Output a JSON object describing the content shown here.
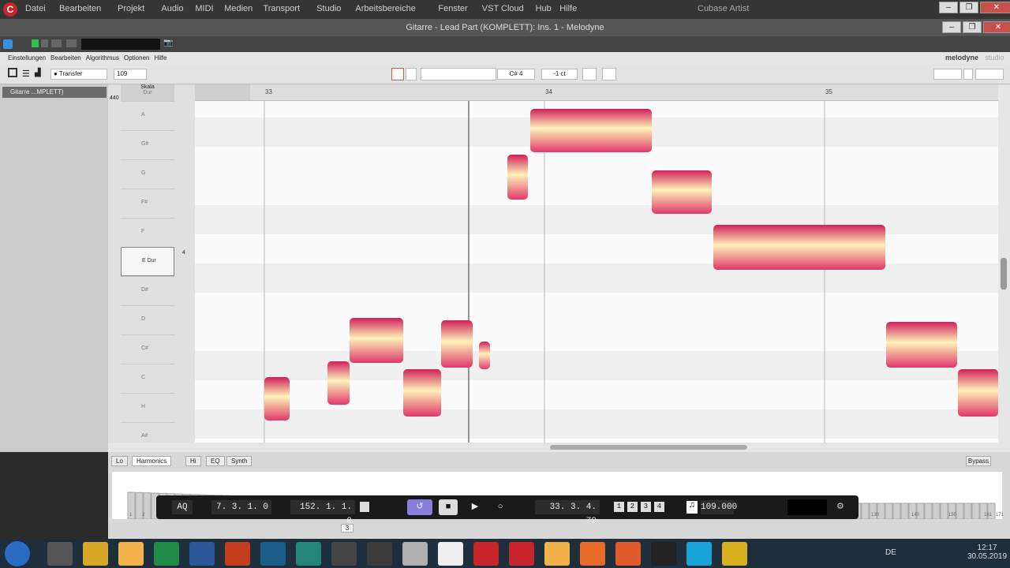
{
  "cubase": {
    "menu": [
      "Datei",
      "Bearbeiten",
      "Projekt",
      "Audio",
      "MIDI",
      "Medien",
      "Transport",
      "Studio",
      "Arbeitsbereiche",
      "Fenster",
      "VST Cloud",
      "Hub",
      "Hilfe"
    ],
    "app_name": "Cubase Artist"
  },
  "plugin": {
    "title": "Gitarre - Lead Part (KOMPLETT): Ins. 1 - Melodyne"
  },
  "melodyne": {
    "menu": [
      "Einstellungen",
      "Bearbeiten",
      "Algorithmus",
      "Optionen",
      "Hilfe"
    ],
    "brand": "melodyne",
    "brand_edition": "studio",
    "transfer_label": "Transfer",
    "tempo": "109",
    "pitch_note": "C# 4",
    "cents": "-1 ct",
    "track_name": "Gitarre ...MPLETT)",
    "scale_header": "Skala",
    "scale_sub": "Dur",
    "ref_pitch": "440",
    "key_count": "4",
    "keys": [
      "A",
      "G#",
      "G",
      "F#",
      "F",
      "E Dur",
      "D#",
      "D",
      "C#",
      "C",
      "H",
      "A#"
    ],
    "selected_key": "E Dur",
    "ruler": [
      "33",
      "34",
      "35"
    ]
  },
  "bottom": {
    "tabs": [
      "Lo",
      "Harmonics",
      "Hi",
      "EQ",
      "Synth"
    ],
    "active_tab": "Harmonics",
    "bypass": "Bypass",
    "scale_labels": [
      "1",
      "2",
      "130",
      "140",
      "150",
      "161",
      "171"
    ],
    "page_num": "3"
  },
  "transport": {
    "aq": "AQ",
    "left_locator": "7. 3. 1.   0",
    "right_locator": "152. 1. 1.   0",
    "position": "33. 3. 4. 79",
    "tempo": "109.000",
    "markers": [
      "1",
      "2",
      "3",
      "4"
    ]
  },
  "taskbar": {
    "lang": "DE",
    "time": "12:17",
    "date": "30.05.2019"
  }
}
